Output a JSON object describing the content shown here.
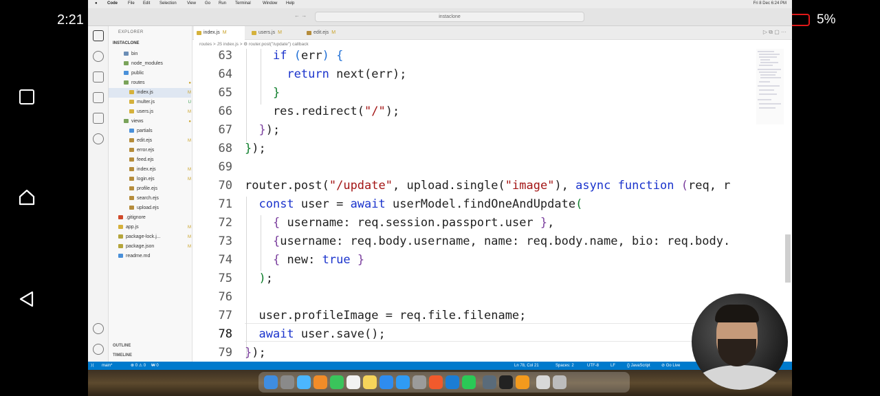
{
  "status_bar": {
    "time": "2:21",
    "battery": "5%",
    "battery_color": "#e01919"
  },
  "mac": {
    "menu": [
      "Code",
      "File",
      "Edit",
      "Selection",
      "View",
      "Go",
      "Run",
      "Terminal",
      "Window",
      "Help"
    ],
    "clock": "Fri 8 Dec 6:24 PM",
    "search": "instaclone"
  },
  "sidebar": {
    "title": "EXPLORER",
    "project": "INSTACLONE",
    "items": [
      {
        "label": "bin",
        "color": "#6b8db5",
        "badge": ""
      },
      {
        "label": "node_modules",
        "color": "#7aa35a",
        "badge": ""
      },
      {
        "label": "public",
        "color": "#4a90d9",
        "badge": ""
      },
      {
        "label": "routes",
        "color": "#7aa35a",
        "badge": "●"
      },
      {
        "label": "index.js",
        "color": "#d5b13b",
        "badge": "M"
      },
      {
        "label": "multer.js",
        "color": "#d5b13b",
        "badge": "U"
      },
      {
        "label": "users.js",
        "color": "#d5b13b",
        "badge": "M"
      },
      {
        "label": "views",
        "color": "#7aa35a",
        "badge": "●"
      },
      {
        "label": "partials",
        "color": "#4a90d9",
        "badge": ""
      },
      {
        "label": "edit.ejs",
        "color": "#b58c3b",
        "badge": "M"
      },
      {
        "label": "error.ejs",
        "color": "#b58c3b",
        "badge": ""
      },
      {
        "label": "feed.ejs",
        "color": "#b58c3b",
        "badge": ""
      },
      {
        "label": "index.ejs",
        "color": "#b58c3b",
        "badge": "M"
      },
      {
        "label": "login.ejs",
        "color": "#b58c3b",
        "badge": "M"
      },
      {
        "label": "profile.ejs",
        "color": "#b58c3b",
        "badge": ""
      },
      {
        "label": "search.ejs",
        "color": "#b58c3b",
        "badge": ""
      },
      {
        "label": "upload.ejs",
        "color": "#b58c3b",
        "badge": ""
      },
      {
        "label": ".gitignore",
        "color": "#d04a2a",
        "badge": ""
      },
      {
        "label": "app.js",
        "color": "#d5b13b",
        "badge": "M"
      },
      {
        "label": "package-lock.j...",
        "color": "#b5a53b",
        "badge": "M"
      },
      {
        "label": "package.json",
        "color": "#b5a53b",
        "badge": "M"
      },
      {
        "label": "readme.md",
        "color": "#4a90d9",
        "badge": ""
      }
    ],
    "outline": "OUTLINE",
    "timeline": "TIMELINE"
  },
  "tabs": [
    {
      "label": "index.js",
      "mod": "M"
    },
    {
      "label": "users.js",
      "mod": "M"
    },
    {
      "label": "edit.ejs",
      "mod": "M"
    }
  ],
  "breadcrumb": "routes > JS index.js > ⚙ router.post(\"/update\") callback",
  "editor": {
    "line_numbers": [
      "63",
      "64",
      "65",
      "66",
      "67",
      "68",
      "69",
      "70",
      "71",
      "72",
      "73",
      "74",
      "75",
      "76",
      "77",
      "78",
      "79"
    ],
    "current_line": "78"
  },
  "vscode_status": {
    "branch": "main*",
    "problems": "⊗ 0 ⚠ 0",
    "ports": "₩ 0",
    "position": "Ln 78, Col 21",
    "spaces": "Spaces: 2",
    "encoding": "UTF-8",
    "eol": "LF",
    "language": "{} JavaScript",
    "golive": "⊘ Go Live"
  }
}
